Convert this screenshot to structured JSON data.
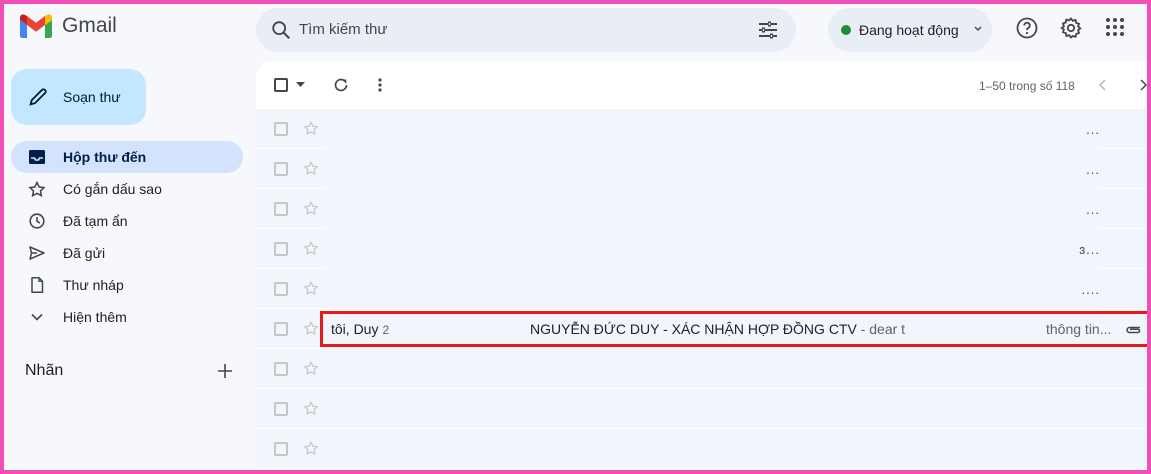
{
  "app": {
    "name": "Gmail",
    "brand_colors": {
      "red": "#ea4335",
      "blue": "#4285f4",
      "green": "#34a853",
      "yellow": "#fbbc04"
    }
  },
  "header": {
    "search_placeholder": "Tìm kiếm thư",
    "status_label": "Đang hoạt động",
    "icons": [
      "search-icon",
      "tune-icon",
      "chevron-down-icon",
      "help-icon",
      "gear-icon",
      "apps-grid-icon"
    ]
  },
  "sidebar": {
    "compose_label": "Soạn thư",
    "items": [
      {
        "label": "Hộp thư đến",
        "icon": "inbox-icon",
        "active": true
      },
      {
        "label": "Có gắn dấu sao",
        "icon": "star-icon",
        "active": false
      },
      {
        "label": "Đã tạm ẩn",
        "icon": "clock-icon",
        "active": false
      },
      {
        "label": "Đã gửi",
        "icon": "send-icon",
        "active": false
      },
      {
        "label": "Thư nháp",
        "icon": "draft-icon",
        "active": false
      },
      {
        "label": "Hiện thêm",
        "icon": "chevron-down-icon",
        "active": false
      }
    ],
    "labels_title": "Nhãn"
  },
  "toolbar": {
    "pager_text": "1–50 trong số 118"
  },
  "emails": {
    "truncated_suffixes": [
      "...",
      "...",
      "...",
      "ɜ...",
      "...."
    ],
    "highlighted": {
      "sender": "tôi, Duy",
      "count": "2",
      "subject": "NGUYỄN ĐỨC DUY - XÁC NHẬN HỢP ĐỒNG CTV",
      "snippet": " - dear t",
      "attachment_text": "thông tin..."
    }
  },
  "accent_colors": {
    "frame": "#f04fb8",
    "highlight_box": "#e31b1b",
    "active_nav": "#d3e3fd",
    "compose": "#c2e7ff"
  }
}
